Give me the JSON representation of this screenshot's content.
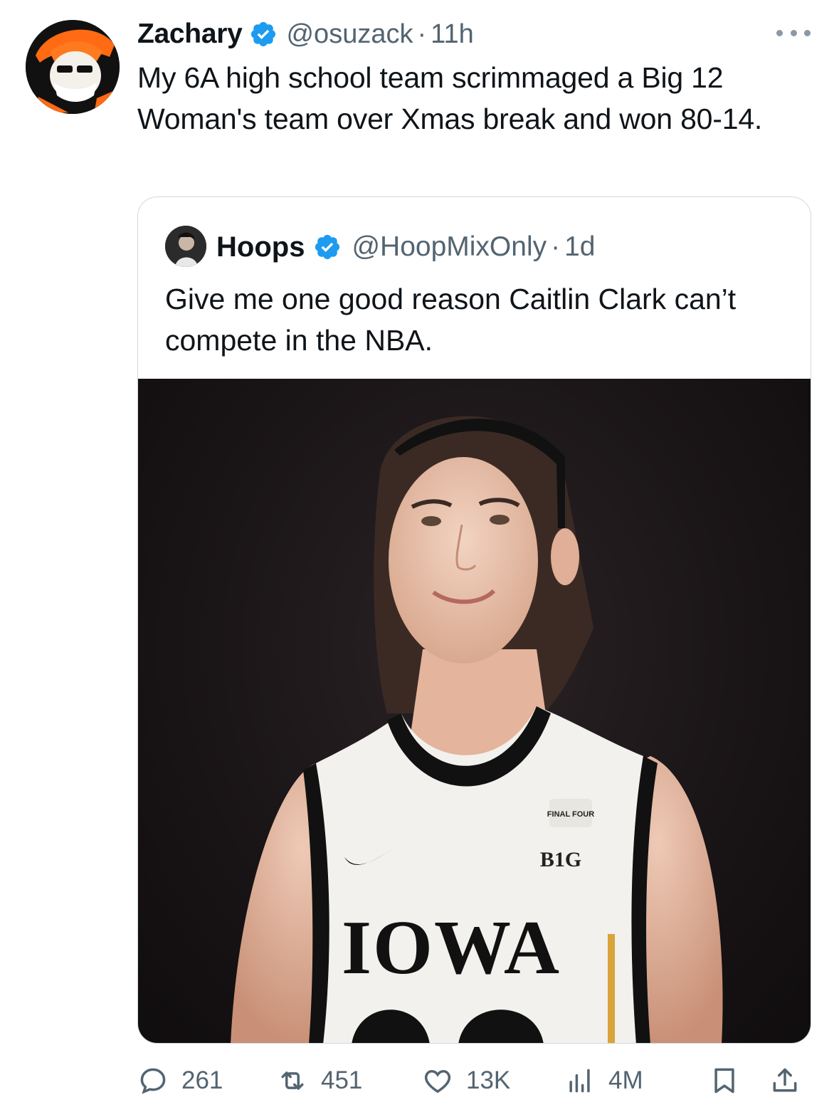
{
  "tweet": {
    "author_name": "Zachary",
    "author_handle": "@osuzack",
    "separator": "·",
    "time": "11h",
    "text": "My 6A high school team scrimmaged a Big 12 Woman's team over Xmas break and won 80-14."
  },
  "quoted_tweet": {
    "author_name": "Hoops",
    "author_handle": "@HoopMixOnly",
    "separator": "·",
    "time": "1d",
    "text": "Give me one good reason Caitlin Clark can’t compete in the NBA.",
    "image": {
      "jersey_text": "IOWA",
      "patch_text": "FINAL FOUR",
      "conference_logo": "B1G"
    }
  },
  "actions": {
    "replies": "261",
    "reposts": "451",
    "likes": "13K",
    "views": "4M"
  },
  "icons": {
    "verified": "verified-badge-icon",
    "more": "more-dots-icon",
    "reply": "reply-icon",
    "repost": "repost-icon",
    "like": "heart-icon",
    "views": "views-chart-icon",
    "bookmark": "bookmark-icon",
    "share": "share-icon"
  },
  "colors": {
    "verified_blue": "#1d9bf0",
    "text_primary": "#0f1419",
    "text_secondary": "#536471",
    "border": "#cfd9de",
    "osu_orange": "#ff6a13"
  }
}
